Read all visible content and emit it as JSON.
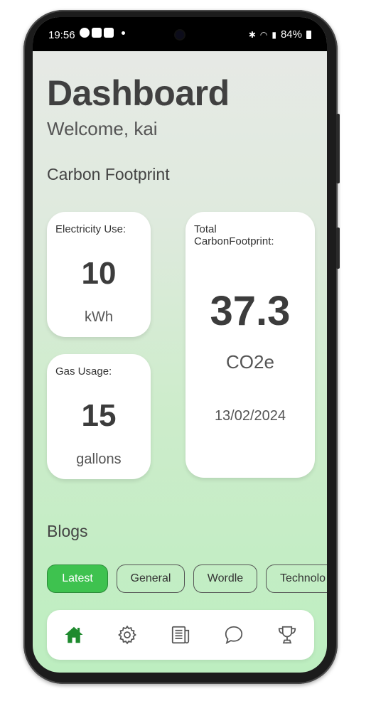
{
  "status_bar": {
    "time": "19:56",
    "battery": "84%",
    "left_icons": [
      "notification-a-icon",
      "gallery-icon",
      "youtube-icon"
    ],
    "right_icons": [
      "bluetooth-icon",
      "wifi-icon",
      "volte-icon",
      "signal-icon",
      "battery-icon"
    ]
  },
  "header": {
    "title": "Dashboard",
    "welcome": "Welcome, kai"
  },
  "carbon": {
    "section_title": "Carbon Footprint",
    "electricity": {
      "label": "Electricity Use:",
      "value": "10",
      "unit": "kWh"
    },
    "gas": {
      "label": "Gas Usage:",
      "value": "15",
      "unit": "gallons"
    },
    "total": {
      "label_line1": "Total",
      "label_line2": "CarbonFootprint:",
      "value": "37.3",
      "unit": "CO2e",
      "date": "13/02/2024"
    }
  },
  "blogs": {
    "section_title": "Blogs",
    "chips": [
      {
        "label": "Latest",
        "active": true
      },
      {
        "label": "General",
        "active": false
      },
      {
        "label": "Wordle",
        "active": false
      },
      {
        "label": "Technolo",
        "active": false
      }
    ]
  },
  "nav": {
    "items": [
      "home-icon",
      "settings-icon",
      "news-icon",
      "chat-icon",
      "trophy-icon"
    ],
    "active_color": "#1e8a2e",
    "inactive_color": "#555555"
  },
  "colors": {
    "accent": "#3ec24f",
    "gradient_top": "#e8e9e7",
    "gradient_bottom": "#bdeec0"
  }
}
